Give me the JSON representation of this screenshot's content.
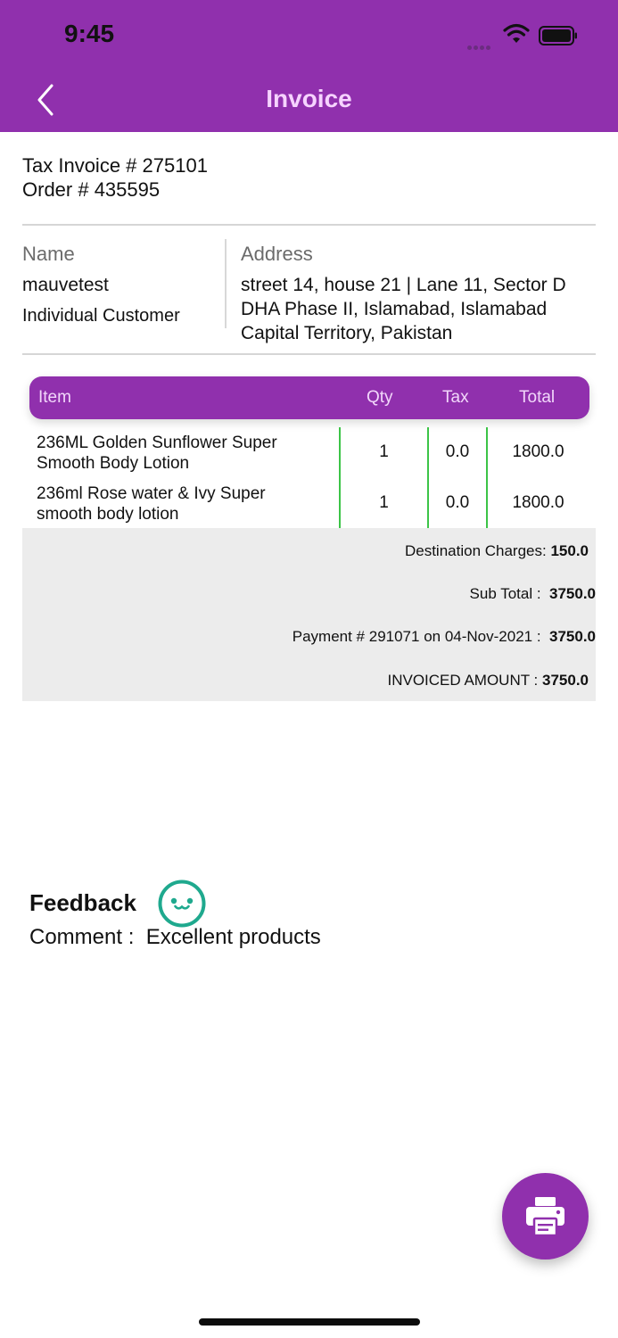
{
  "status_bar": {
    "time": "9:45"
  },
  "header": {
    "title": "Invoice",
    "back_icon": "chevron-left-icon"
  },
  "invoice": {
    "tax_invoice": "Tax Invoice # 275101",
    "order": "Order # 435595"
  },
  "customer": {
    "name_label": "Name",
    "name": "mauvetest",
    "type": "Individual Customer",
    "address_label": "Address",
    "address_lines": [
      "street 14, house 21 | Lane 11, Sector D",
      "DHA Phase II, Islamabad, Islamabad",
      "Capital Territory, Pakistan"
    ]
  },
  "table": {
    "headers": [
      "Item",
      "Qty",
      "Tax",
      "Total"
    ],
    "rows": [
      {
        "item_line1": "236ML Golden Sunflower Super",
        "item_line2": "Smooth Body Lotion",
        "qty": "1",
        "tax": "0.0",
        "total": "1800.0"
      },
      {
        "item_line1": "236ml Rose water & Ivy Super",
        "item_line2": "smooth body lotion",
        "qty": "1",
        "tax": "0.0",
        "total": "1800.0"
      }
    ]
  },
  "summary": {
    "destination_label": "Destination Charges: ",
    "destination_value": "150.0",
    "subtotal_label": "Sub Total :  ",
    "subtotal_value": "3750.0",
    "payment_label": "Payment # 291071 on 04-Nov-2021 :  ",
    "payment_value": "3750.0",
    "invoiced_label": "INVOICED AMOUNT : ",
    "invoiced_value": "3750.0"
  },
  "feedback": {
    "title": "Feedback",
    "icon": "happy-face-icon",
    "icon_color": "#1fa98e",
    "comment": "Comment :  Excellent products"
  },
  "fab": {
    "icon": "printer-icon"
  },
  "colors": {
    "brand": "#9030ad",
    "title_text": "#f6d3ff",
    "divider_green": "#3cc447",
    "summary_bg": "#ececec"
  }
}
